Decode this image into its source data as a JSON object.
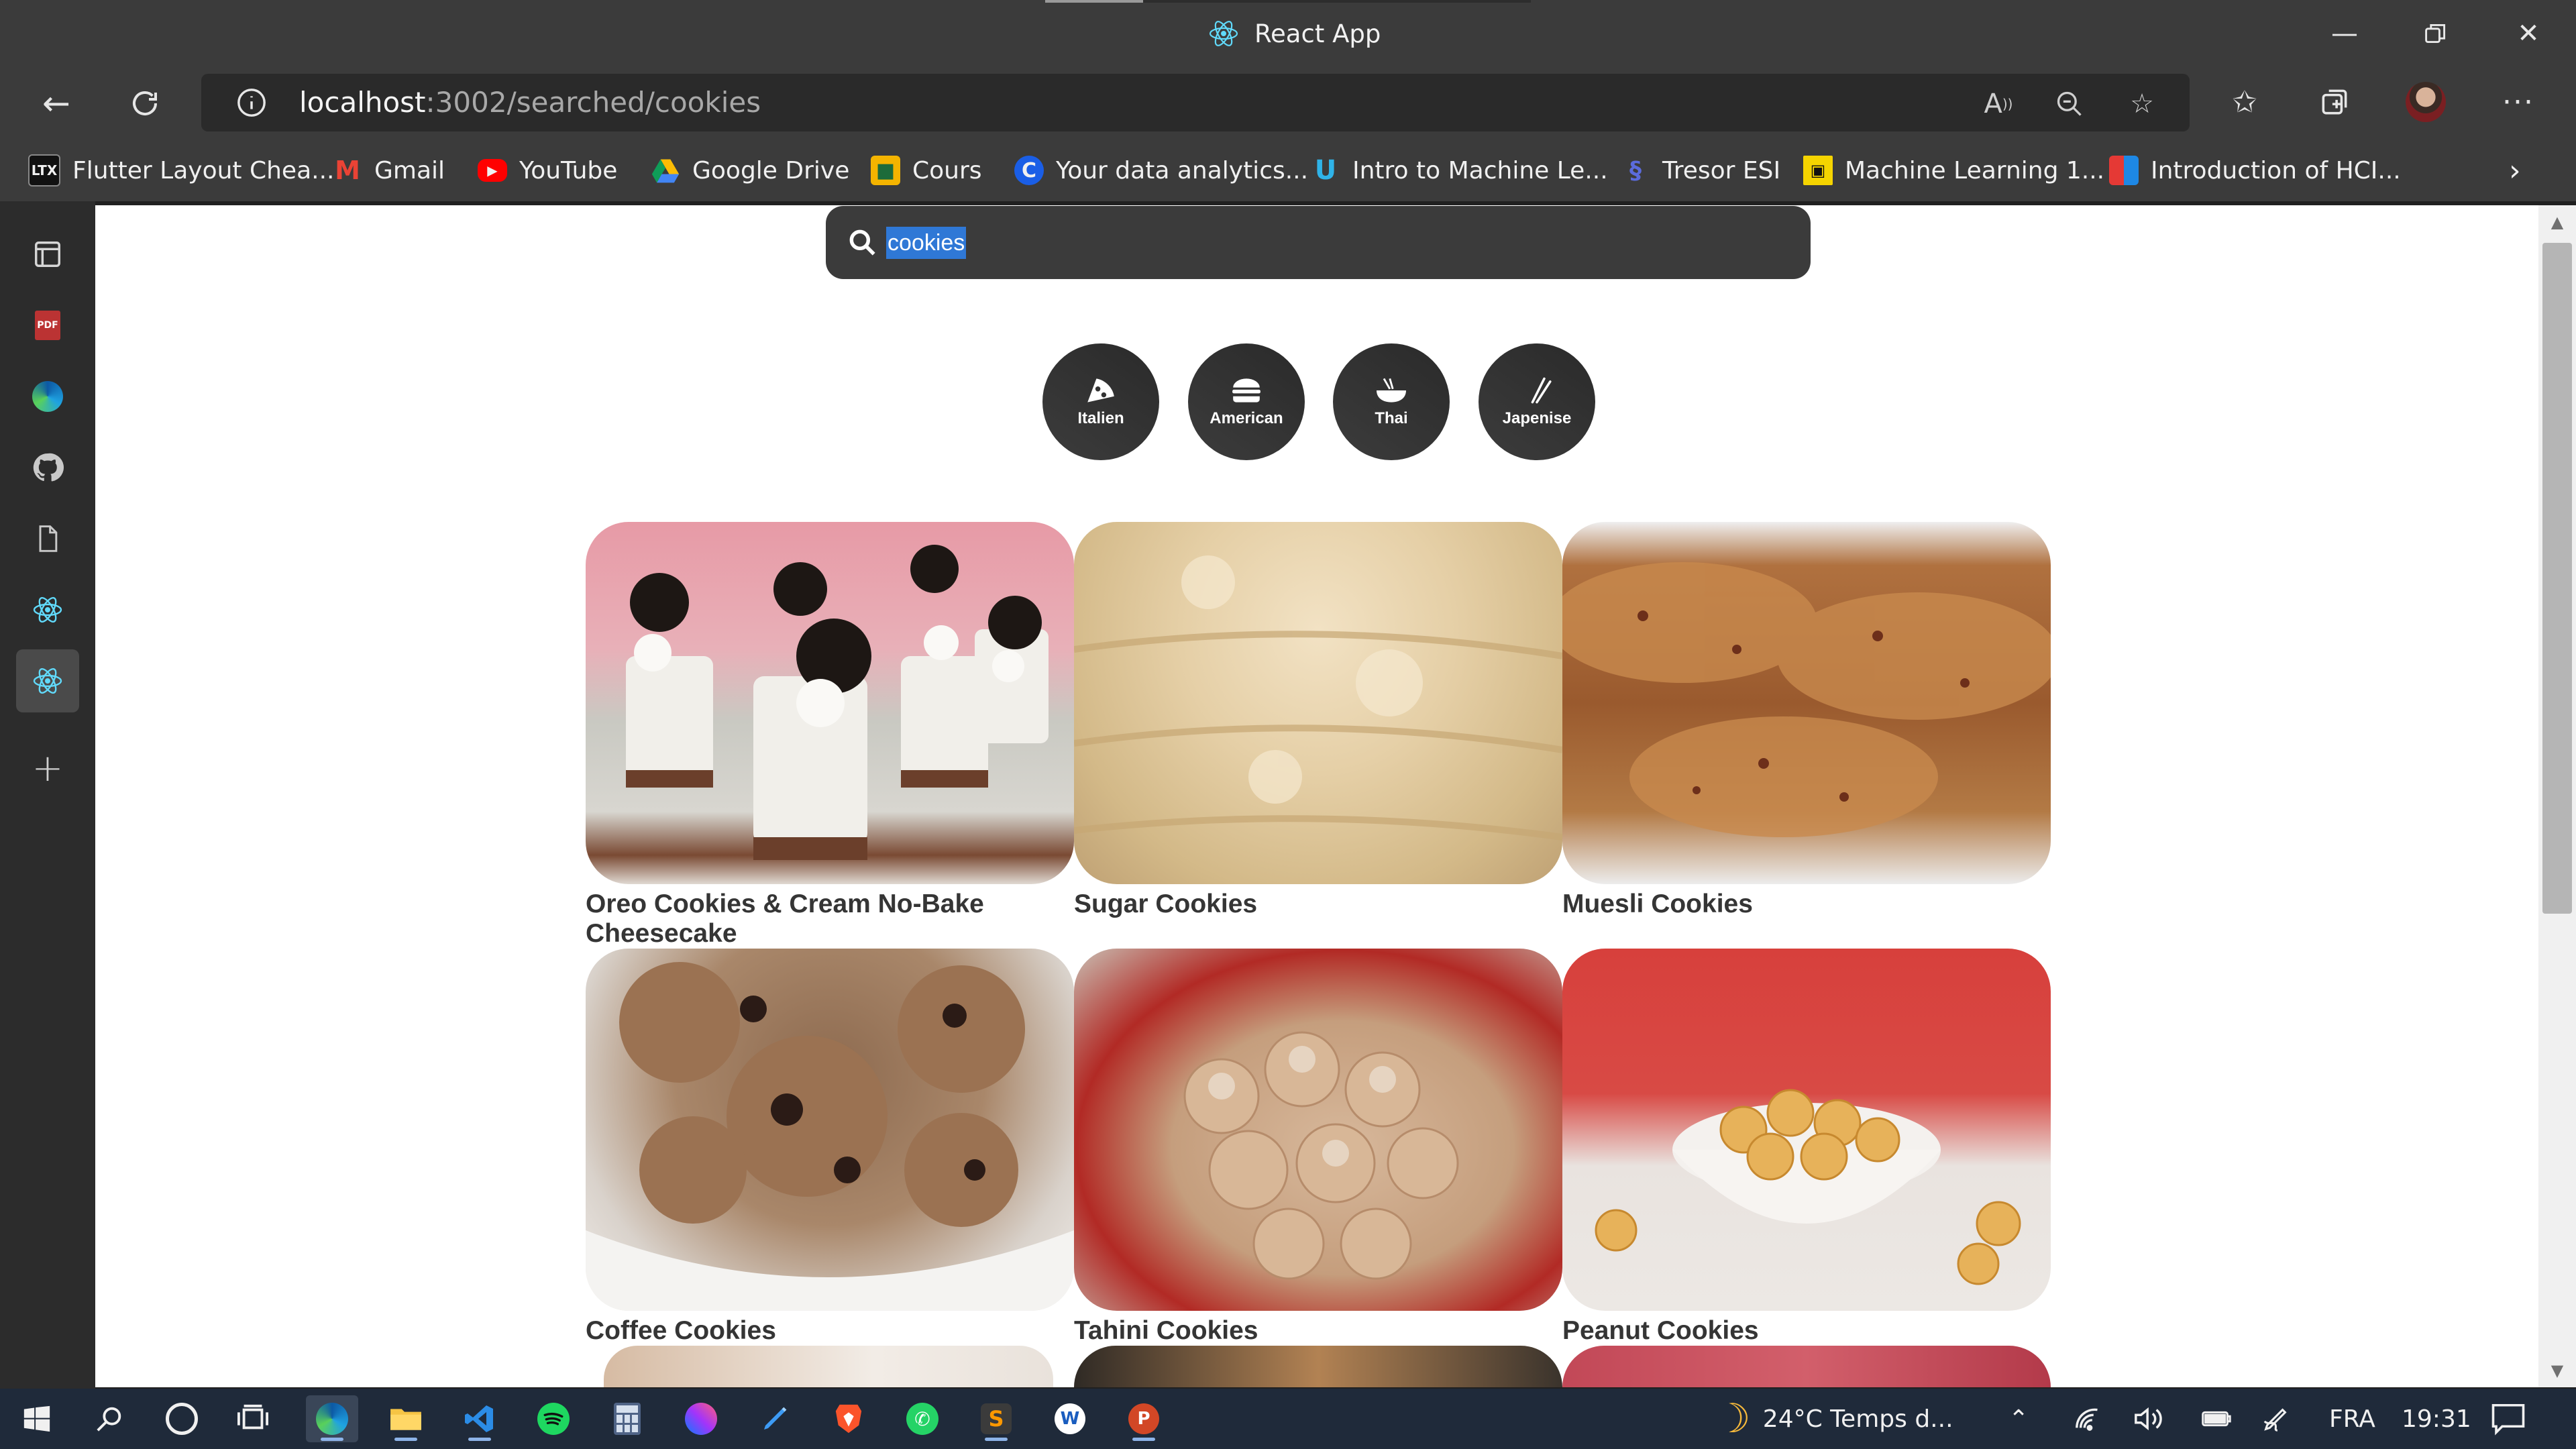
{
  "window": {
    "title": "React App",
    "controls": [
      "minimize",
      "restore",
      "close"
    ]
  },
  "browser": {
    "url_host": "localhost",
    "url_path": ":3002/searched/cookies",
    "favorites": [
      {
        "label": "Flutter Layout Chea...",
        "icon": "ltx-icon"
      },
      {
        "label": "Gmail",
        "icon": "gmail-icon"
      },
      {
        "label": "YouTube",
        "icon": "youtube-icon"
      },
      {
        "label": "Google Drive",
        "icon": "google-drive-icon"
      },
      {
        "label": "Cours",
        "icon": "classroom-icon"
      },
      {
        "label": "Your data analytics...",
        "icon": "coursera-icon"
      },
      {
        "label": "Intro to Machine Le...",
        "icon": "udacity-icon"
      },
      {
        "label": "Tresor ESI",
        "icon": "tresor-icon"
      },
      {
        "label": "Machine Learning 1...",
        "icon": "ml-course-icon"
      },
      {
        "label": "Introduction of HCI...",
        "icon": "bookmark-icon"
      }
    ]
  },
  "sidebar": {
    "items": [
      "tab-actions-icon",
      "pdf-icon",
      "edge-icon",
      "github-icon",
      "file-icon",
      "react-icon",
      "react-icon-active",
      "add-icon"
    ]
  },
  "search": {
    "value": "cookies"
  },
  "categories": [
    {
      "label": "Italien",
      "icon": "pizza-icon"
    },
    {
      "label": "American",
      "icon": "burger-icon"
    },
    {
      "label": "Thai",
      "icon": "noodles-icon"
    },
    {
      "label": "Japenise",
      "icon": "chopsticks-icon"
    }
  ],
  "recipes": [
    {
      "title": "Oreo Cookies & Cream No-Bake Cheesecake"
    },
    {
      "title": "Sugar Cookies"
    },
    {
      "title": "Muesli Cookies"
    },
    {
      "title": "Coffee Cookies"
    },
    {
      "title": "Tahini Cookies"
    },
    {
      "title": "Peanut Cookies"
    }
  ],
  "taskbar": {
    "apps": [
      "windows-start-icon",
      "search-icon",
      "cortana-icon",
      "task-view-icon",
      "edge-icon",
      "file-explorer-icon",
      "vscode-icon",
      "spotify-icon",
      "calculator-icon",
      "messenger-icon",
      "pen-app-icon",
      "brave-icon",
      "whatsapp-icon",
      "sublime-icon",
      "word-icon",
      "powerpoint-icon"
    ],
    "weather": "24°C  Temps d...",
    "language": "FRA",
    "time": "19:31"
  },
  "colors": {
    "chrome": "#3b3b3b",
    "sidebar": "#2c2c2c",
    "search_box": "#3b3b3b",
    "category_button": "#333333",
    "title_text": "#353535",
    "selection": "#2f78d6",
    "taskbar": "#1f2a3a"
  }
}
